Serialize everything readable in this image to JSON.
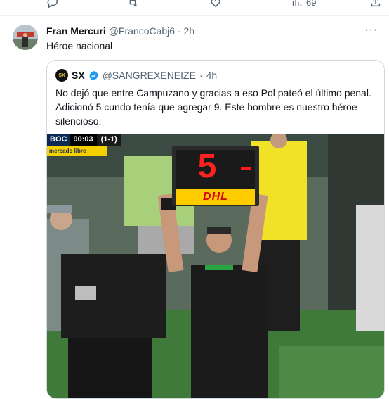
{
  "top_actions": {
    "views_count": "69"
  },
  "post": {
    "author_name": "Fran Mercuri",
    "author_handle": "@FrancoCabj6",
    "separator": "·",
    "time": "2h",
    "text": "Héroe nacional"
  },
  "quote": {
    "author_name": "SX",
    "author_handle": "@SANGREXENEIZE",
    "separator": "·",
    "time": "4h",
    "text": "No dejó que entre Campuzano y gracias a eso Pol pateó el último penal. Adicionó 5 cundo tenía que agregar 9. Este hombre es nuestro héroe silencioso.",
    "avatar_text": "SX"
  },
  "media": {
    "team": "BOC",
    "clock": "90:03",
    "score": "(1-1)",
    "sponsor": "mercado libre",
    "board_number": "5",
    "board_brand": "DHL"
  },
  "colors": {
    "verified": "#1d9bf0",
    "text_secondary": "#536471",
    "border": "#cfd9de",
    "dhl_yellow": "#ffcc00",
    "dhl_red": "#d40511"
  },
  "icons": [
    "reply-icon",
    "repost-icon",
    "like-icon",
    "views-icon",
    "share-icon",
    "more-icon",
    "verified-icon"
  ]
}
